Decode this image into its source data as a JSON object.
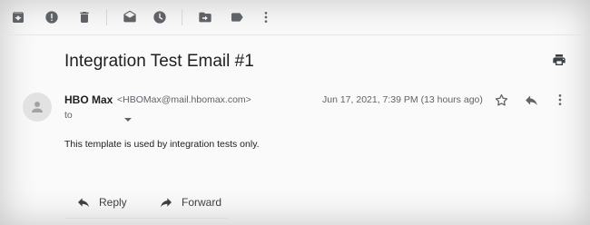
{
  "toolbar": {
    "icons": [
      "archive-icon",
      "report-spam-icon",
      "delete-icon",
      "mark-unread-icon",
      "snooze-icon",
      "move-to-icon",
      "label-icon",
      "more-vert-icon"
    ]
  },
  "message": {
    "subject": "Integration Test Email #1",
    "sender_name": "HBO Max",
    "sender_email": "<HBOMax@mail.hbomax.com>",
    "to_label": "to",
    "date": "Jun 17, 2021, 7:39 PM (13 hours ago)",
    "body": "This template is used by integration tests only."
  },
  "actions": {
    "reply_label": "Reply",
    "forward_label": "Forward"
  },
  "colors": {
    "icon": "#5f6368",
    "text": "#202124",
    "secondary_text": "#5f6368"
  }
}
